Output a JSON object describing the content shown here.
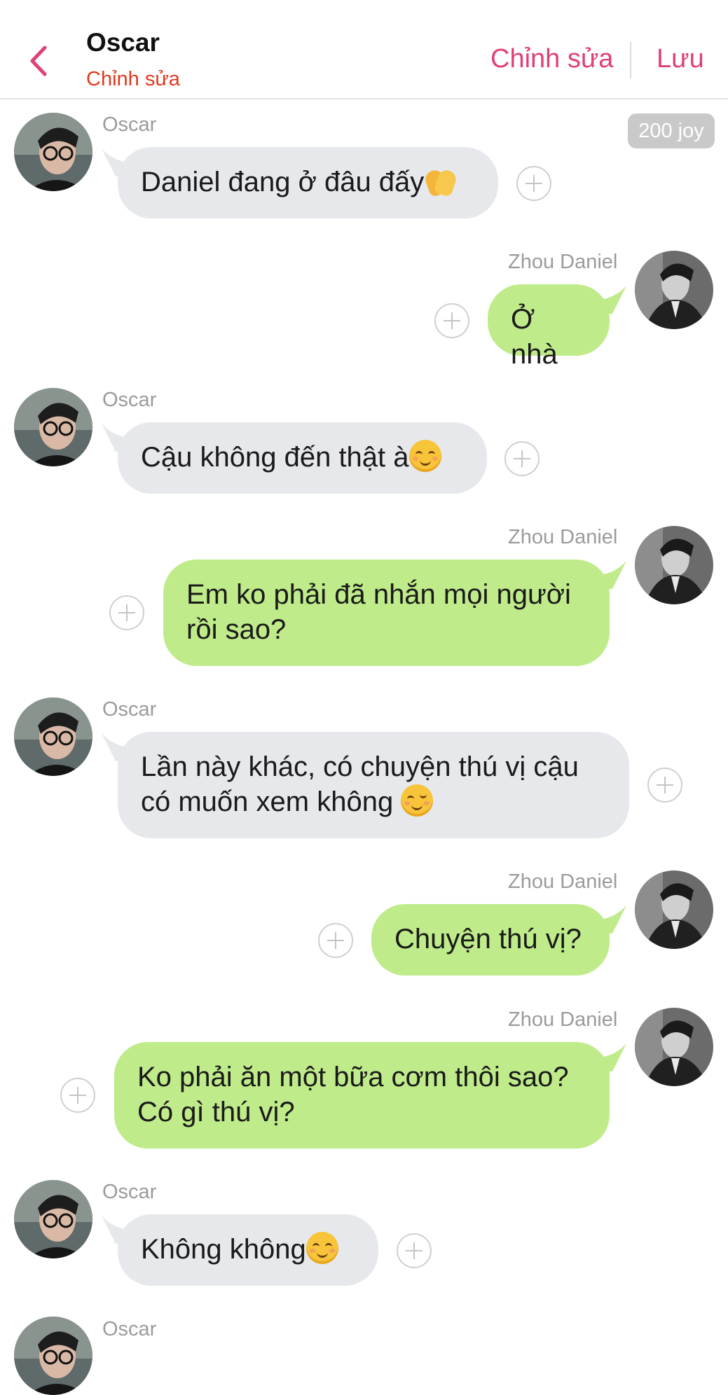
{
  "header": {
    "title": "Oscar",
    "subtitle": "Chỉnh sửa",
    "edit_label": "Chỉnh sửa",
    "save_label": "Lưu",
    "accent_color": "#e0407a",
    "subtitle_color": "#e0391e"
  },
  "joy_badge": "200 joy",
  "messages": [
    {
      "sender": "Oscar",
      "text": "Daniel đang ở đâu đấy",
      "emoji": "clapping-hands",
      "direction": "incoming"
    },
    {
      "sender": "Zhou Daniel",
      "text": "Ở nhà",
      "direction": "outgoing"
    },
    {
      "sender": "Oscar",
      "text": "Cậu không đến thật à",
      "emoji": "relieved-face",
      "direction": "incoming"
    },
    {
      "sender": "Zhou Daniel",
      "text": "Em ko phải đã nhắn mọi người\nrồi sao?",
      "direction": "outgoing"
    },
    {
      "sender": "Oscar",
      "text": "Lần này khác, có chuyện thú vị cậu\ncó muốn xem không ",
      "emoji": "winking-face",
      "direction": "incoming"
    },
    {
      "sender": "Zhou Daniel",
      "text": "Chuyện thú vị?",
      "direction": "outgoing"
    },
    {
      "sender": "Zhou Daniel",
      "text": "Ko phải ăn một bữa cơm thôi sao?\nCó gì thú vị?",
      "direction": "outgoing"
    },
    {
      "sender": "Oscar",
      "text": "Không không",
      "emoji": "relieved-face",
      "direction": "incoming"
    },
    {
      "sender": "Oscar",
      "direction": "incoming"
    }
  ],
  "colors": {
    "incoming_bubble": "#e6e8eb",
    "outgoing_bubble": "#bfeb8a",
    "joy_badge_bg": "#c9c9c9"
  }
}
